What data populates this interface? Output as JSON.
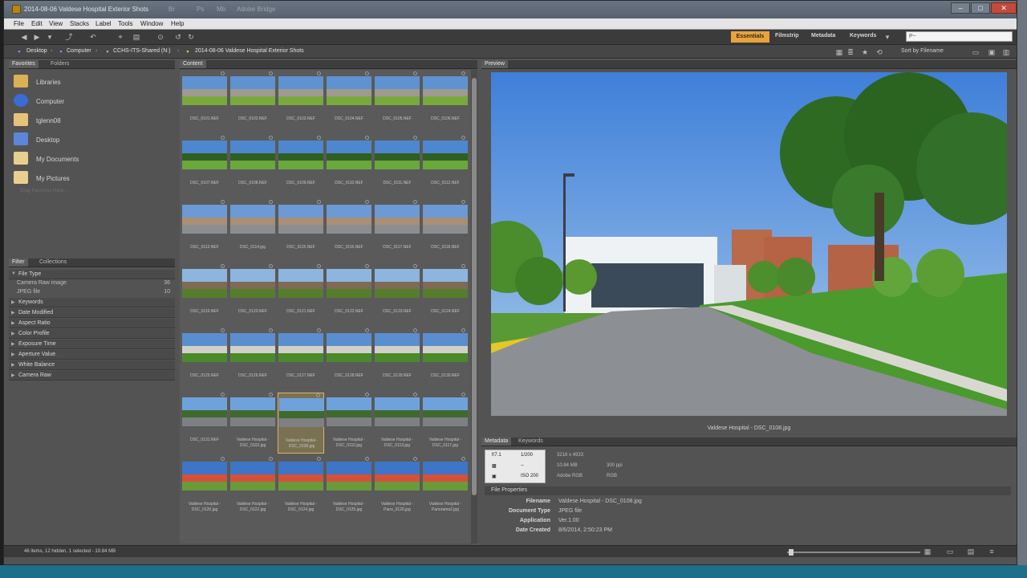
{
  "window": {
    "title": "2014-08-06 Valdese Hospital Exterior Shots",
    "title_menus": [
      "Br",
      "Ps",
      "Mb",
      "Adobe Bridge"
    ]
  },
  "menu": [
    "File",
    "Edit",
    "View",
    "Stacks",
    "Label",
    "Tools",
    "Window",
    "Help"
  ],
  "workspaces": {
    "active": "Essentials",
    "items": [
      "Filmstrip",
      "Metadata",
      "Keywords"
    ]
  },
  "search": {
    "value": "P~"
  },
  "path": {
    "segments": [
      "Desktop",
      "Computer",
      "CCHS-ITS-Shared (N:)",
      "2014-08-06 Valdese Hospital Exterior Shots"
    ]
  },
  "sort": {
    "label": "Sort by Filename"
  },
  "panels": {
    "favorites": {
      "tabs": [
        "Favorites",
        "Folders"
      ]
    },
    "filter": {
      "tabs": [
        "Filter",
        "Collections"
      ]
    },
    "content": {
      "tab": "Content"
    },
    "preview": {
      "tab": "Preview"
    },
    "metadata": {
      "tabs": [
        "Metadata",
        "Keywords"
      ]
    }
  },
  "favorites": [
    {
      "label": "Libraries",
      "icon": "libraries-icon",
      "color": "#d8b255"
    },
    {
      "label": "Computer",
      "icon": "computer-icon",
      "color": "#3b6bd4"
    },
    {
      "label": "tglenn08",
      "icon": "user-folder-icon",
      "color": "#e7c27a"
    },
    {
      "label": "Desktop",
      "icon": "desktop-icon",
      "color": "#5d86d8"
    },
    {
      "label": "My Documents",
      "icon": "documents-icon",
      "color": "#e9cf8f"
    },
    {
      "label": "My Pictures",
      "icon": "pictures-icon",
      "color": "#e9cf8f"
    }
  ],
  "favorites_hint": "Drag Favorites Here...",
  "filters": [
    {
      "label": "File Type",
      "sub": [
        {
          "label": "Camera Raw image",
          "count": "36"
        },
        {
          "label": "JPEG file",
          "count": "10"
        }
      ]
    },
    {
      "label": "Keywords"
    },
    {
      "label": "Date Modified"
    },
    {
      "label": "Aspect Ratio"
    },
    {
      "label": "Color Profile"
    },
    {
      "label": "Exposure Time"
    },
    {
      "label": "Aperture Value"
    },
    {
      "label": "White Balance"
    },
    {
      "label": "Camera Raw"
    }
  ],
  "thumbnails": {
    "rows": [
      [
        "DSC_0101.NEF",
        "DSC_0102.NEF",
        "DSC_0103.NEF",
        "DSC_0104.NEF",
        "DSC_0105.NEF",
        "DSC_0106.NEF"
      ],
      [
        "DSC_0107.NEF",
        "DSC_0108.NEF",
        "DSC_0109.NEF",
        "DSC_0110.NEF",
        "DSC_0111.NEF",
        "DSC_0112.NEF"
      ],
      [
        "DSC_0113.NEF",
        "DSC_0114.jpg",
        "DSC_0115.NEF",
        "DSC_0116.NEF",
        "DSC_0117.NEF",
        "DSC_0118.NEF"
      ],
      [
        "DSC_0119.NEF",
        "DSC_0120.NEF",
        "DSC_0121.NEF",
        "DSC_0122.NEF",
        "DSC_0123.NEF",
        "DSC_0124.NEF"
      ],
      [
        "DSC_0125.NEF",
        "DSC_0126.NEF",
        "DSC_0127.NEF",
        "DSC_0128.NEF",
        "DSC_0129.NEF",
        "DSC_0130.NEF"
      ],
      [
        "DSC_0131.NEF",
        "Valdese Hospital - DSC_0102.jpg",
        "Valdese Hospital - DSC_0108.jpg",
        "Valdese Hospital - DSC_0110.jpg",
        "Valdese Hospital - DSC_0113.jpg",
        "Valdese Hospital - DSC_0117.jpg"
      ],
      [
        "Valdese Hospital - DSC_0120.jpg",
        "Valdese Hospital - DSC_0122.jpg",
        "Valdese Hospital - DSC_0124.jpg",
        "Valdese Hospital - DSC_0125.jpg",
        "Valdese Hospital - Pano_0126.jpg",
        "Valdese Hospital - Panorama2.jpg"
      ]
    ],
    "selected": "Valdese Hospital - DSC_0108.jpg"
  },
  "preview": {
    "caption": "Valdese Hospital - DSC_0108.jpg"
  },
  "metadata": {
    "aperture": "f/7.1",
    "shutter": "1/200",
    "metering": "--",
    "iso": "ISO 200",
    "dimensions": "3216 x 4933",
    "size": "10.84 MB",
    "resolution": "300 ppi",
    "color_profile": "Adobe RGB",
    "color_mode": "RGB"
  },
  "file_properties": {
    "header": "File Properties",
    "rows": [
      {
        "key": "Filename",
        "value": "Valdese Hospital - DSC_0108.jpg"
      },
      {
        "key": "Document Type",
        "value": "JPEG file"
      },
      {
        "key": "Application",
        "value": "Ver.1.00"
      },
      {
        "key": "Date Created",
        "value": "8/6/2014, 2:50:23 PM"
      }
    ]
  },
  "status": "46 items, 12 hidden, 1 selected - 10.84 MB"
}
